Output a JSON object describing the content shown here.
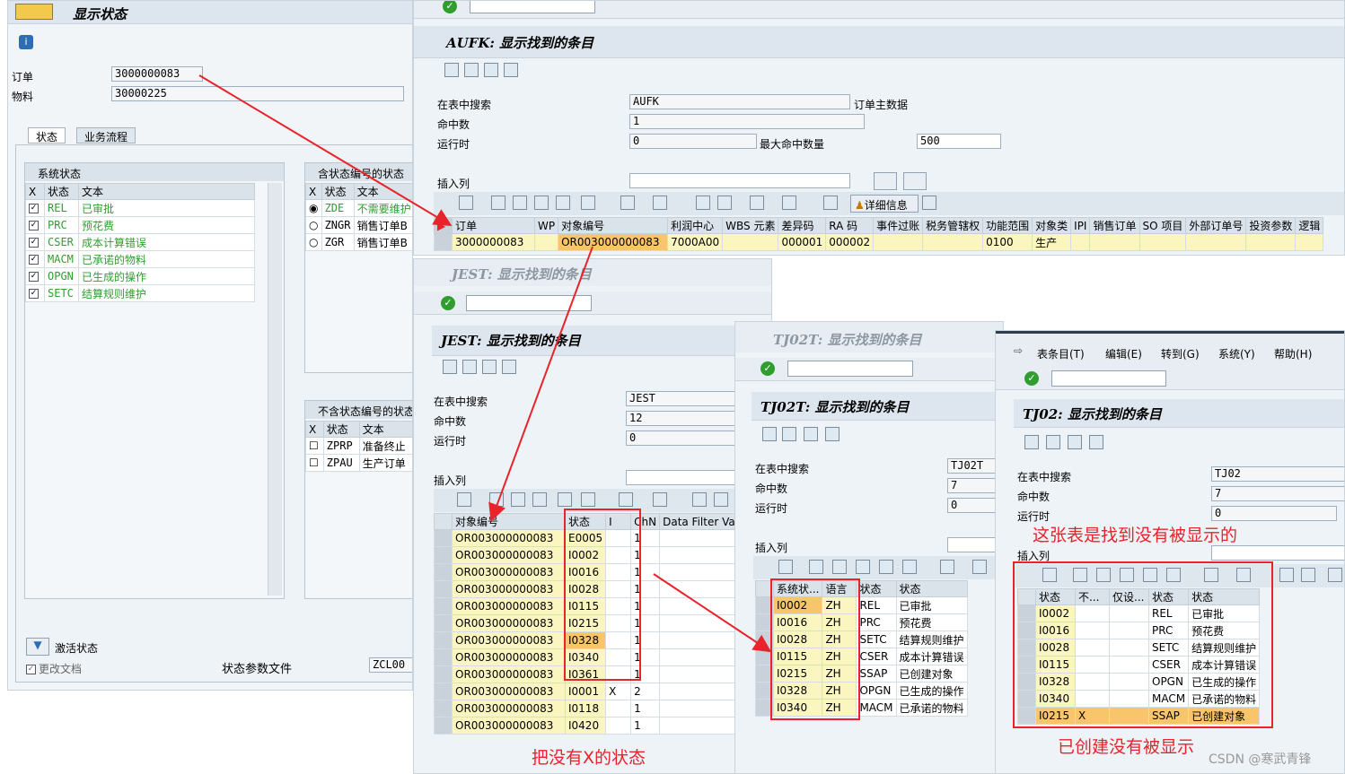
{
  "status_win": {
    "title": "显示状态",
    "order_label": "订单",
    "order_value": "3000000083",
    "material_label": "物料",
    "material_value": "30000225",
    "tabs": [
      "状态",
      "业务流程"
    ],
    "sys_status": {
      "title": "系统状态",
      "cols": [
        "X",
        "状态",
        "文本"
      ],
      "rows": [
        [
          "✓",
          "REL",
          "已审批"
        ],
        [
          "✓",
          "PRC",
          "预花费"
        ],
        [
          "✓",
          "CSER",
          "成本计算错误"
        ],
        [
          "✓",
          "MACM",
          "已承诺的物料"
        ],
        [
          "✓",
          "OPGN",
          "已生成的操作"
        ],
        [
          "✓",
          "SETC",
          "结算规则维护"
        ]
      ]
    },
    "with_status": {
      "title": "含状态编号的状态",
      "cols": [
        "X",
        "状态",
        "文本"
      ],
      "rows": [
        [
          "◉",
          "ZDE",
          "不需要维护"
        ],
        [
          "○",
          "ZNGR",
          "销售订单B"
        ],
        [
          "○",
          "ZGR",
          "销售订单B"
        ]
      ]
    },
    "without_status": {
      "title": "不含状态编号的状态",
      "cols": [
        "X",
        "状态",
        "文本"
      ],
      "rows": [
        [
          "☐",
          "ZPRP",
          "准备终止"
        ],
        [
          "☐",
          "ZPAU",
          "生产订单"
        ]
      ]
    },
    "activate_label": "激活状态",
    "change_doc_label": "更改文档",
    "profile_label": "状态参数文件",
    "profile_value": "ZCL00"
  },
  "aufk": {
    "title": "AUFK: 显示找到的条目",
    "search_label": "在表中搜索",
    "search_value": "AUFK",
    "search_desc": "订单主数据",
    "hits_label": "命中数",
    "hits_value": "1",
    "runtime_label": "运行时",
    "runtime_value": "0",
    "maxhits_label": "最大命中数量",
    "maxhits_value": "500",
    "insert_label": "插入列",
    "detail_label": "详细信息",
    "cols": [
      "订单",
      "WP",
      "对象编号",
      "利润中心",
      "WBS 元素",
      "差异码",
      "RA 码",
      "事件过账",
      "税务管辖权",
      "功能范围",
      "对象类",
      "IPI",
      "销售订单",
      "SO 项目",
      "外部订单号",
      "投资参数",
      "逻辑"
    ],
    "row": [
      "3000000083",
      "",
      "OR003000000083",
      "7000A00",
      "",
      "000001",
      "000002",
      "",
      "",
      "0100",
      "生产",
      "",
      "",
      "",
      "",
      "",
      ""
    ]
  },
  "jest": {
    "title_bar": "JEST: 显示找到的条目",
    "title": "JEST: 显示找到的条目",
    "search_label": "在表中搜索",
    "search_value": "JEST",
    "hits_label": "命中数",
    "hits_value": "12",
    "runtime_label": "运行时",
    "runtime_value": "0",
    "insert_label": "插入列",
    "cols": [
      "对象编号",
      "状态",
      "I",
      "ChN",
      "Data Filter Valu"
    ],
    "rows": [
      [
        "OR003000000083",
        "E0005",
        "",
        "1"
      ],
      [
        "OR003000000083",
        "I0002",
        "",
        "1"
      ],
      [
        "OR003000000083",
        "I0016",
        "",
        "1"
      ],
      [
        "OR003000000083",
        "I0028",
        "",
        "1"
      ],
      [
        "OR003000000083",
        "I0115",
        "",
        "1"
      ],
      [
        "OR003000000083",
        "I0215",
        "",
        "1"
      ],
      [
        "OR003000000083",
        "I0328",
        "",
        "1"
      ],
      [
        "OR003000000083",
        "I0340",
        "",
        "1"
      ],
      [
        "OR003000000083",
        "I0361",
        "",
        "1"
      ],
      [
        "OR003000000083",
        "I0001",
        "X",
        "2"
      ],
      [
        "OR003000000083",
        "I0118",
        "",
        "1"
      ],
      [
        "OR003000000083",
        "I0420",
        "",
        "1"
      ]
    ]
  },
  "tj02t": {
    "title_bar": "TJ02T: 显示找到的条目",
    "title": "TJ02T: 显示找到的条目",
    "search_label": "在表中搜索",
    "search_value": "TJ02T",
    "hits_label": "命中数",
    "hits_value": "7",
    "runtime_label": "运行时",
    "runtime_value": "0",
    "insert_label": "插入列",
    "cols": [
      "系统状...",
      "语言",
      "状态",
      "状态"
    ],
    "rows": [
      [
        "I0002",
        "ZH",
        "REL",
        "已审批"
      ],
      [
        "I0016",
        "ZH",
        "PRC",
        "预花费"
      ],
      [
        "I0028",
        "ZH",
        "SETC",
        "结算规则维护"
      ],
      [
        "I0115",
        "ZH",
        "CSER",
        "成本计算错误"
      ],
      [
        "I0215",
        "ZH",
        "SSAP",
        "已创建对象"
      ],
      [
        "I0328",
        "ZH",
        "OPGN",
        "已生成的操作"
      ],
      [
        "I0340",
        "ZH",
        "MACM",
        "已承诺的物料"
      ]
    ]
  },
  "tj02": {
    "menu": [
      "表条目(T)",
      "编辑(E)",
      "转到(G)",
      "系统(Y)",
      "帮助(H)"
    ],
    "title": "TJ02: 显示找到的条目",
    "search_label": "在表中搜索",
    "search_value": "TJ02",
    "hits_label": "命中数",
    "hits_value": "7",
    "runtime_label": "运行时",
    "runtime_value": "0",
    "insert_label": "插入列",
    "cols": [
      "状态",
      "不...",
      "仅设...",
      "状态",
      "状态"
    ],
    "rows": [
      [
        "I0002",
        "",
        "",
        "REL",
        "已审批"
      ],
      [
        "I0016",
        "",
        "",
        "PRC",
        "预花费"
      ],
      [
        "I0028",
        "",
        "",
        "SETC",
        "结算规则维护"
      ],
      [
        "I0115",
        "",
        "",
        "CSER",
        "成本计算错误"
      ],
      [
        "I0328",
        "",
        "",
        "OPGN",
        "已生成的操作"
      ],
      [
        "I0340",
        "",
        "",
        "MACM",
        "已承诺的物料"
      ],
      [
        "I0215",
        "X",
        "",
        "SSAP",
        "已创建对象"
      ]
    ]
  },
  "notes": {
    "n1": "这张表是找到没有被显示的",
    "n2": "把没有X的状态",
    "n3": "已创建没有被显示"
  },
  "watermark": "CSDN @寒武青锋"
}
